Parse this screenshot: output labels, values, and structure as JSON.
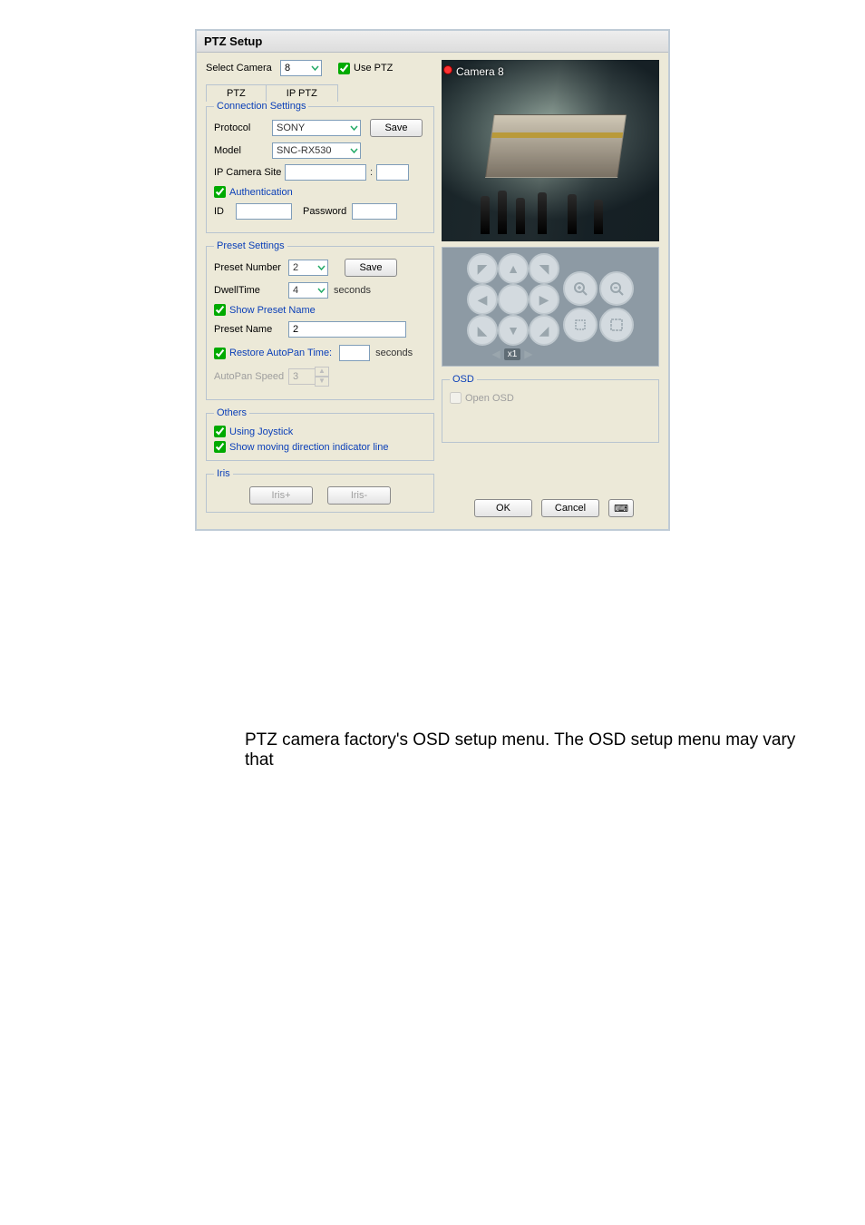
{
  "window": {
    "title": "PTZ Setup"
  },
  "top": {
    "select_camera": "Select Camera",
    "camera_value": "8",
    "use_ptz": "Use PTZ"
  },
  "tabs": {
    "ptz": "PTZ",
    "ipptz": "IP PTZ"
  },
  "conn": {
    "legend": "Connection Settings",
    "protocol": "Protocol",
    "protocol_value": "SONY",
    "model": "Model",
    "model_value": "SNC-RX530",
    "ipsite": "IP Camera Site",
    "ipsite_sep": ":",
    "auth": "Authentication",
    "id": "ID",
    "pwd": "Password",
    "save": "Save"
  },
  "preset": {
    "legend": "Preset Settings",
    "number": "Preset Number",
    "number_value": "2",
    "save": "Save",
    "dwell": "DwellTime",
    "dwell_value": "4",
    "seconds": "seconds",
    "show_name": "Show Preset Name",
    "name": "Preset Name",
    "name_value": "2",
    "restore": "Restore AutoPan Time:",
    "ap_speed": "AutoPan Speed",
    "ap_value": "3"
  },
  "others": {
    "legend": "Others",
    "joy": "Using Joystick",
    "line": "Show moving direction indicator line"
  },
  "iris": {
    "legend": "Iris",
    "plus": "Iris+",
    "minus": "Iris-"
  },
  "preview": {
    "camera_label": "Camera 8",
    "speed_label": "x1"
  },
  "osd": {
    "legend": "OSD",
    "open": "Open OSD"
  },
  "footer": {
    "ok": "OK",
    "cancel": "Cancel",
    "kbd": "⌨"
  },
  "doc": {
    "caption": "PTZ camera factory's OSD setup menu. The OSD setup menu may vary that"
  }
}
